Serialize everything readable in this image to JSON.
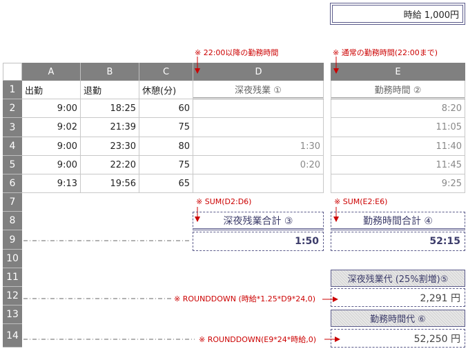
{
  "wage_box": "時給 1,000円",
  "notes": {
    "d_note": "※ 22:00以降の勤務時間",
    "e_note": "※ 通常の勤務時間(22:00まで)",
    "sum_d": "※ SUM(D2:D6)",
    "sum_e": "※ SUM(E2:E6)",
    "round12": "※ ROUNDDOWN (時給*1.25*D9*24,0)",
    "round14": "※ ROUNDDOWN(E9*24*時給,0)"
  },
  "columns": [
    "A",
    "B",
    "C",
    "D",
    "E"
  ],
  "row_numbers": [
    "1",
    "2",
    "3",
    "4",
    "5",
    "6",
    "7",
    "8",
    "9",
    "10",
    "11",
    "12",
    "13",
    "14"
  ],
  "header_row": {
    "a": "出勤",
    "b": "退勤",
    "c": "休憩(分)",
    "d": "深夜残業 ①",
    "e": "勤務時間 ②"
  },
  "rows": [
    {
      "a": "9:00",
      "b": "18:25",
      "c": "60",
      "d": "",
      "e": "8:20"
    },
    {
      "a": "9:02",
      "b": "21:39",
      "c": "75",
      "d": "",
      "e": "11:05"
    },
    {
      "a": "9:00",
      "b": "23:30",
      "c": "80",
      "d": "1:30",
      "e": "11:40"
    },
    {
      "a": "9:00",
      "b": "22:20",
      "c": "75",
      "d": "0:20",
      "e": "11:45"
    },
    {
      "a": "9:13",
      "b": "19:56",
      "c": "65",
      "d": "",
      "e": "9:25"
    }
  ],
  "totals": {
    "d_label": "深夜残業合計 ③",
    "e_label": "勤務時間合計 ④",
    "d_value": "1:50",
    "e_value": "52:15"
  },
  "pay": {
    "late_label": "深夜残業代 (25%割増)⑤",
    "late_value": "2,291 円",
    "work_label": "勤務時間代 ⑥",
    "work_value": "52,250 円"
  },
  "colors": {
    "header_gray": "#808080",
    "note_red": "#cc0000",
    "border_blue": "#5a5a8a"
  }
}
